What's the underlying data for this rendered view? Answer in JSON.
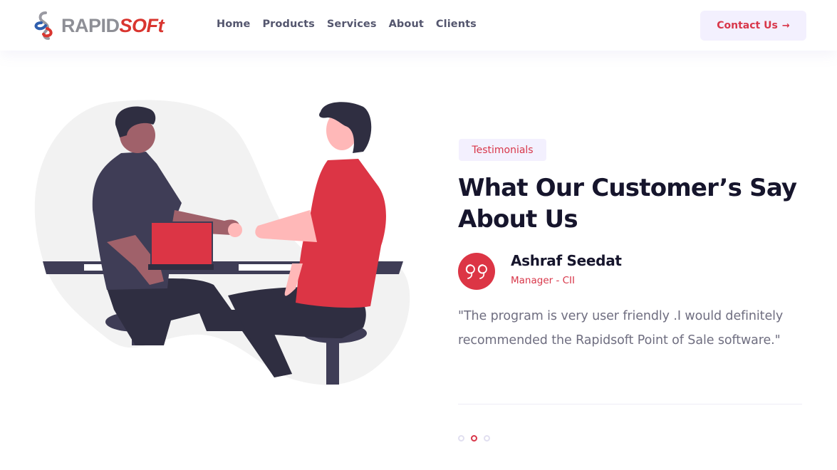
{
  "header": {
    "logo": {
      "part1": "RAPID",
      "part2": "SOFt"
    },
    "nav": [
      {
        "label": "Home"
      },
      {
        "label": "Products"
      },
      {
        "label": "Services"
      },
      {
        "label": "About"
      },
      {
        "label": "Clients"
      }
    ],
    "contact_button": {
      "label": "Contact Us",
      "icon": "arrow-right-icon",
      "arrow": "→"
    }
  },
  "illustration": {
    "alt": "two people shaking hands across a desk with a laptop"
  },
  "testimonials": {
    "badge": "Testimonials",
    "title": "What Our Customer’s Say About Us",
    "quote_icon": "quote-icon",
    "author": {
      "name": "Ashraf Seedat",
      "role": "Manager - CII"
    },
    "quote": "\"The program is very user friendly .I would definitely recommended the Rapidsoft Point of Sale software.\"",
    "pagination": {
      "total": 3,
      "active_index": 1
    }
  },
  "colors": {
    "accent": "#dc3545",
    "heading": "#16152c",
    "nav_text": "#54566e",
    "body_text": "#6f6e80",
    "badge_bg": "#f3f0fe",
    "blob": "#f2f2f2",
    "dark_clothes": "#3f3d56",
    "dark_hair": "#2f2e41",
    "skin_dark": "#a0616a",
    "skin_light": "#ffb8b8"
  }
}
